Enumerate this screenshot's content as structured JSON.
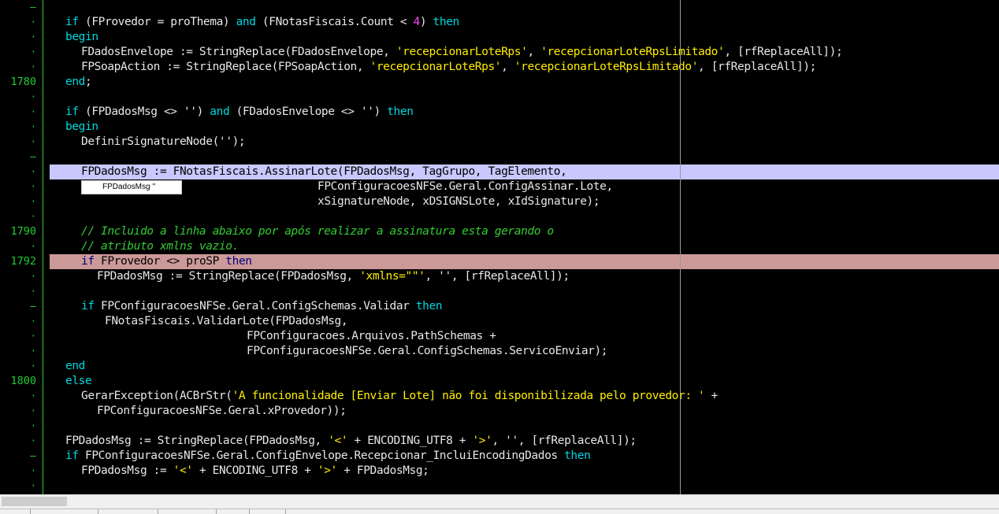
{
  "editor": {
    "lines": [
      {
        "gutter": "–",
        "indent": 0,
        "tokens": []
      },
      {
        "gutter": "·",
        "indent": 1,
        "tokens": [
          [
            "kw",
            "if"
          ],
          [
            "id",
            " (FProvedor = proThema) "
          ],
          [
            "kw",
            "and"
          ],
          [
            "id",
            " (FNotasFiscais.Count < "
          ],
          [
            "num",
            "4"
          ],
          [
            "id",
            ") "
          ],
          [
            "kw",
            "then"
          ]
        ]
      },
      {
        "gutter": "·",
        "indent": 1,
        "tokens": [
          [
            "kw",
            "begin"
          ]
        ]
      },
      {
        "gutter": "·",
        "indent": 2,
        "tokens": [
          [
            "id",
            "FDadosEnvelope := StringReplace(FDadosEnvelope, "
          ],
          [
            "str",
            "'recepcionarLoteRps'"
          ],
          [
            "id",
            ", "
          ],
          [
            "str",
            "'recepcionarLoteRpsLimitado'"
          ],
          [
            "id",
            ", [rfReplaceAll]);"
          ]
        ]
      },
      {
        "gutter": "·",
        "indent": 2,
        "tokens": [
          [
            "id",
            "FPSoapAction := StringReplace(FPSoapAction, "
          ],
          [
            "str",
            "'recepcionarLoteRps'"
          ],
          [
            "id",
            ", "
          ],
          [
            "str",
            "'recepcionarLoteRpsLimitado'"
          ],
          [
            "id",
            ", [rfReplaceAll]);"
          ]
        ]
      },
      {
        "gutter": "1780",
        "indent": 1,
        "tokens": [
          [
            "kw",
            "end"
          ],
          [
            "id",
            ";"
          ]
        ]
      },
      {
        "gutter": "·",
        "indent": 0,
        "tokens": []
      },
      {
        "gutter": "·",
        "indent": 1,
        "tokens": [
          [
            "kw",
            "if"
          ],
          [
            "id",
            " (FPDadosMsg <> '') "
          ],
          [
            "kw",
            "and"
          ],
          [
            "id",
            " (FDadosEnvelope <> '') "
          ],
          [
            "kw",
            "then"
          ]
        ]
      },
      {
        "gutter": "·",
        "indent": 1,
        "tokens": [
          [
            "kw",
            "begin"
          ]
        ]
      },
      {
        "gutter": "·",
        "indent": 2,
        "tokens": [
          [
            "id",
            "DefinirSignatureNode('');"
          ]
        ]
      },
      {
        "gutter": "–",
        "indent": 0,
        "tokens": []
      },
      {
        "gutter": "·",
        "indent": 2,
        "hl": "blue",
        "tokens": [
          [
            "idd",
            "FPDadosMsg := FNotasFiscais.AssinarLote(FPDadosMsg, TagGrupo, TagElemento,"
          ]
        ]
      },
      {
        "gutter": "·",
        "indent": 17,
        "tokens": [
          [
            "id",
            "FPConfiguracoesNFSe.Geral.ConfigAssinar.Lote,"
          ]
        ]
      },
      {
        "gutter": "·",
        "indent": 17,
        "tokens": [
          [
            "id",
            "xSignatureNode, xDSIGNSLote, xIdSignature);"
          ]
        ]
      },
      {
        "gutter": "·",
        "indent": 0,
        "tokens": []
      },
      {
        "gutter": "1790",
        "indent": 2,
        "tokens": [
          [
            "cm",
            "// Incluido a linha abaixo por após realizar a assinatura esta gerando o"
          ]
        ]
      },
      {
        "gutter": "·",
        "indent": 2,
        "tokens": [
          [
            "cm",
            "// atributo xmlns vazio."
          ]
        ]
      },
      {
        "gutter": "1792",
        "indent": 2,
        "hl": "red",
        "tokens": [
          [
            "kwd",
            "if"
          ],
          [
            "idd",
            " FProvedor <> proSP "
          ],
          [
            "kwd",
            "then"
          ]
        ]
      },
      {
        "gutter": "·",
        "indent": 3,
        "tokens": [
          [
            "id",
            "FPDadosMsg := StringReplace(FPDadosMsg, "
          ],
          [
            "str",
            "'xmlns=\"\"'"
          ],
          [
            "id",
            ", '', [rfReplaceAll]);"
          ]
        ]
      },
      {
        "gutter": "·",
        "indent": 0,
        "tokens": []
      },
      {
        "gutter": "–",
        "indent": 2,
        "tokens": [
          [
            "kw",
            "if"
          ],
          [
            "id",
            " FPConfiguracoesNFSe.Geral.ConfigSchemas.Validar "
          ],
          [
            "kw",
            "then"
          ]
        ]
      },
      {
        "gutter": "·",
        "indent": 3.5,
        "tokens": [
          [
            "id",
            "FNotasFiscais.ValidarLote(FPDadosMsg,"
          ]
        ]
      },
      {
        "gutter": "·",
        "indent": 12.5,
        "tokens": [
          [
            "id",
            "FPConfiguracoes.Arquivos.PathSchemas +"
          ]
        ]
      },
      {
        "gutter": "·",
        "indent": 12.5,
        "tokens": [
          [
            "id",
            "FPConfiguracoesNFSe.Geral.ConfigSchemas.ServicoEnviar);"
          ]
        ]
      },
      {
        "gutter": "·",
        "indent": 1,
        "tokens": [
          [
            "kw",
            "end"
          ]
        ]
      },
      {
        "gutter": "1800",
        "indent": 1,
        "tokens": [
          [
            "kw",
            "else"
          ]
        ]
      },
      {
        "gutter": "·",
        "indent": 2,
        "tokens": [
          [
            "id",
            "GerarException(ACBrStr("
          ],
          [
            "str",
            "'A funcionalidade [Enviar Lote] não foi disponibilizada pelo provedor: '"
          ],
          [
            "id",
            " +"
          ]
        ]
      },
      {
        "gutter": "·",
        "indent": 3,
        "tokens": [
          [
            "id",
            "FPConfiguracoesNFSe.Geral.xProvedor));"
          ]
        ]
      },
      {
        "gutter": "·",
        "indent": 0,
        "tokens": []
      },
      {
        "gutter": "·",
        "indent": 1,
        "tokens": [
          [
            "id",
            "FPDadosMsg := StringReplace(FPDadosMsg, "
          ],
          [
            "str",
            "'<'"
          ],
          [
            "id",
            " + ENCODING_UTF8 + "
          ],
          [
            "str",
            "'>'"
          ],
          [
            "id",
            ", '', [rfReplaceAll]);"
          ]
        ]
      },
      {
        "gutter": "–",
        "indent": 1,
        "tokens": [
          [
            "kw",
            "if"
          ],
          [
            "id",
            " FPConfiguracoesNFSe.Geral.ConfigEnvelope.Recepcionar_IncluiEncodingDados "
          ],
          [
            "kw",
            "then"
          ]
        ]
      },
      {
        "gutter": "·",
        "indent": 2,
        "tokens": [
          [
            "id",
            "FPDadosMsg := "
          ],
          [
            "str",
            "'<'"
          ],
          [
            "id",
            " + ENCODING_UTF8 + "
          ],
          [
            "str",
            "'>'"
          ],
          [
            "id",
            " + FPDadosMsg;"
          ]
        ]
      },
      {
        "gutter": "·",
        "indent": 0,
        "tokens": []
      }
    ],
    "tooltip": {
      "name": "FPDadosMsg",
      "value": "''"
    }
  },
  "colors": {
    "background": "#000000",
    "keyword": "#00d8e0",
    "string": "#ffee00",
    "number": "#ff44ff",
    "comment": "#33cc33",
    "gutter": "#22cc33",
    "highlight_blue": "#c8c8ff",
    "highlight_breakpoint": "#cc9999"
  }
}
